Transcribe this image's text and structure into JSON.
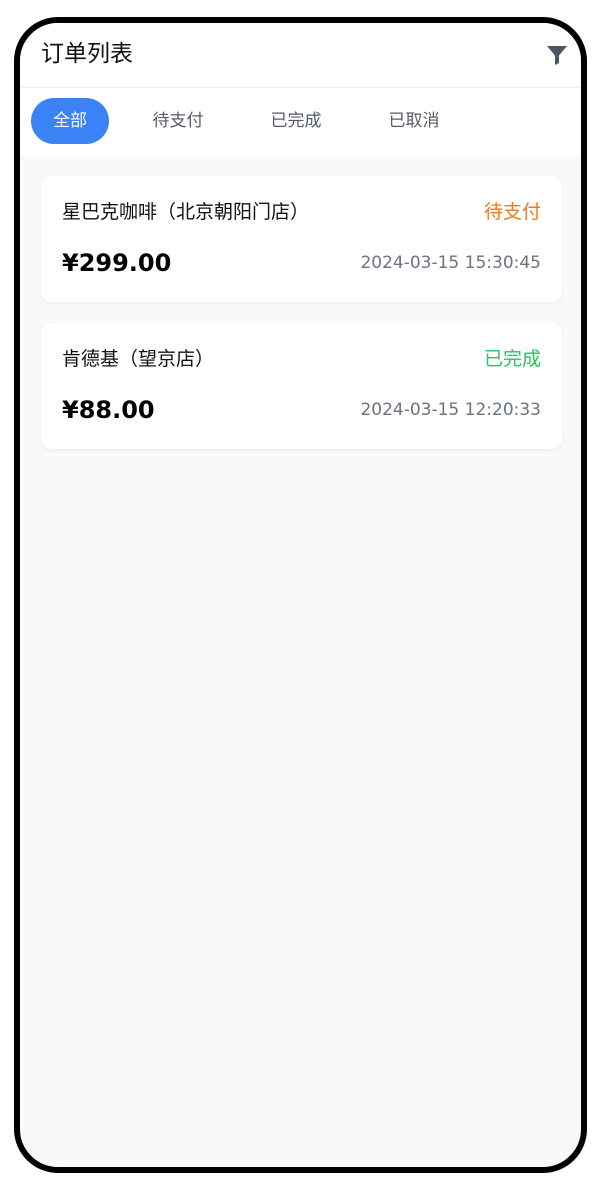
{
  "header": {
    "title": "订单列表",
    "filter_icon": "filter-icon"
  },
  "tabs": [
    {
      "label": "全部",
      "active": true
    },
    {
      "label": "待支付",
      "active": false
    },
    {
      "label": "已完成",
      "active": false
    },
    {
      "label": "已取消",
      "active": false
    }
  ],
  "orders": [
    {
      "store": "星巴克咖啡（北京朝阳门店）",
      "status": "待支付",
      "status_color": "#f07a1a",
      "price": "¥299.00",
      "time": "2024-03-15 15:30:45"
    },
    {
      "store": "肯德基（望京店）",
      "status": "已完成",
      "status_color": "#22c55e",
      "price": "¥88.00",
      "time": "2024-03-15 12:20:33"
    }
  ],
  "colors": {
    "accent": "#3b82f6",
    "background": "#f8f9fb"
  }
}
